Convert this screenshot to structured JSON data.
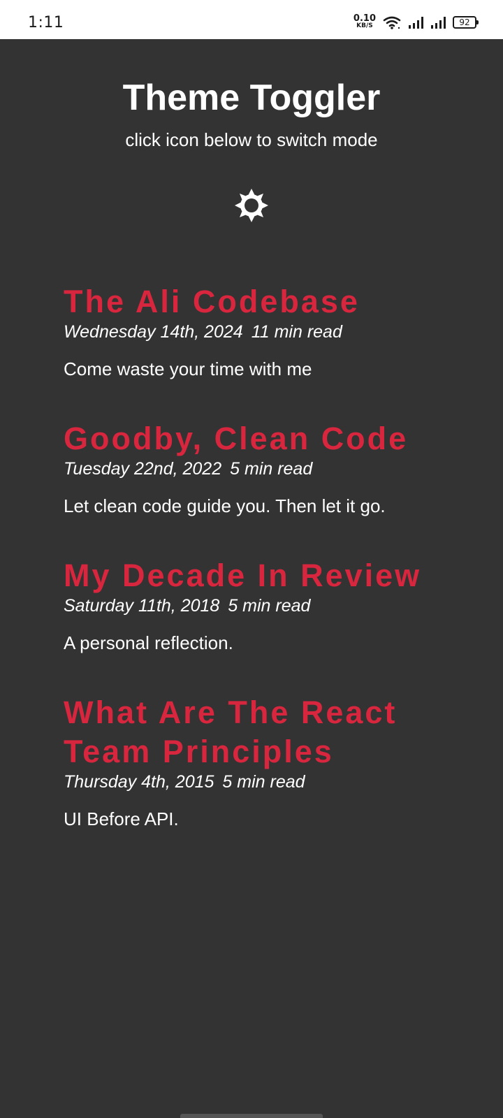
{
  "status_bar": {
    "time": "1:11",
    "net_speed_value": "0.10",
    "net_speed_unit": "KB/S",
    "battery": "92"
  },
  "header": {
    "title": "Theme Toggler",
    "subtitle": "click icon below to switch mode",
    "toggle_icon": "sun-icon"
  },
  "posts": [
    {
      "title": "The Ali Codebase",
      "date": "Wednesday 14th, 2024",
      "read_time": "11 min read",
      "description": "Come waste your time with me"
    },
    {
      "title": "Goodby, Clean Code",
      "date": "Tuesday 22nd, 2022",
      "read_time": "5 min read",
      "description": "Let clean code guide you. Then let it go."
    },
    {
      "title": "My Decade In Review",
      "date": "Saturday 11th, 2018",
      "read_time": "5 min read",
      "description": "A personal reflection."
    },
    {
      "title": "What Are The React Team Principles",
      "date": "Thursday 4th, 2015",
      "read_time": "5 min read",
      "description": "UI Before API."
    }
  ],
  "colors": {
    "background": "#333333",
    "accent": "#d7263d",
    "text": "#ffffff"
  }
}
